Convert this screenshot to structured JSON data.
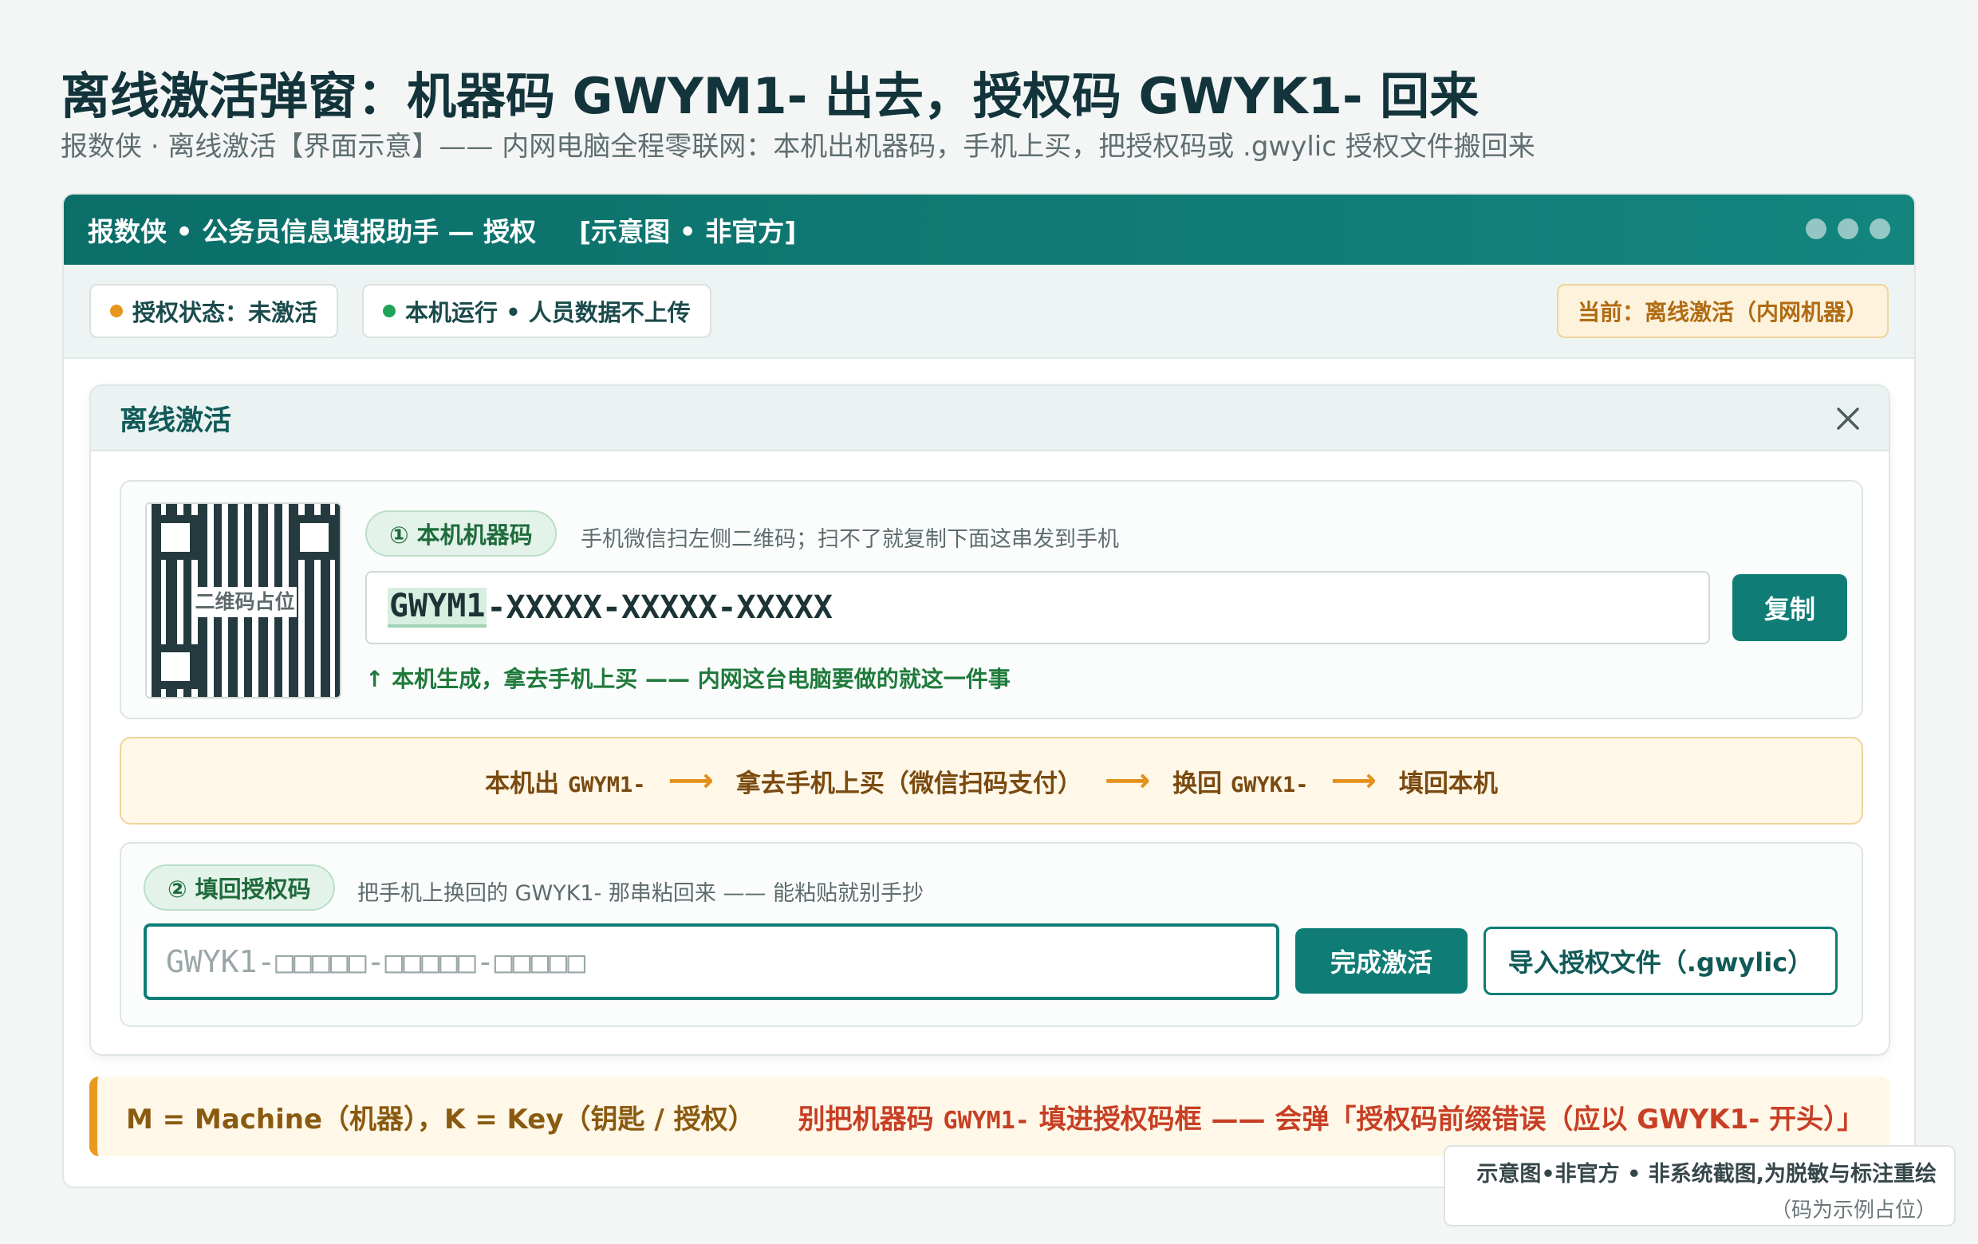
{
  "page": {
    "title": "离线激活弹窗：机器码 GWYM1- 出去，授权码 GWYK1- 回来",
    "subtitle": "报数侠 · 离线激活【界面示意】—— 内网电脑全程零联网：本机出机器码，手机上买，把授权码或 .gwylic 授权文件搬回来"
  },
  "window": {
    "title": "报数侠 • 公务员信息填报助手 — 授权",
    "tag": "[示意图 • 非官方]"
  },
  "status": {
    "license": "授权状态：未激活",
    "license_color": "#e8961e",
    "local": "本机运行 • 人员数据不上传",
    "local_color": "#22a35a",
    "current": "当前：离线激活（内网机器）"
  },
  "dialog": {
    "title": "离线激活",
    "qr_label": "二维码占位",
    "step1": {
      "badge": "① 本机机器码",
      "hint": "手机微信扫左侧二维码；扫不了就复制下面这串发到手机",
      "code_prefix": "GWYM1",
      "code_rest": "-XXXXX-XXXXX-XXXXX",
      "copy_label": "复制",
      "note": "↑ 本机生成，拿去手机上买 —— 内网这台电脑要做的就这一件事"
    },
    "flow": {
      "s1": "本机出",
      "s1_code": "GWYM1-",
      "s2": "拿去手机上买（微信扫码支付）",
      "s3": "换回",
      "s3_code": "GWYK1-",
      "s4": "填回本机"
    },
    "step2": {
      "badge": "② 填回授权码",
      "hint": "把手机上换回的 GWYK1- 那串粘回来 —— 能粘贴就别手抄",
      "placeholder": "GWYK1-□□□□□-□□□□□-□□□□□",
      "activate_label": "完成激活",
      "import_label": "导入授权文件（.gwylic）"
    }
  },
  "bottom_note": {
    "legend": "M = Machine（机器），K = Key（钥匙 / 授权）",
    "warn_a": "别把机器码",
    "warn_code": "GWYM1-",
    "warn_b": "填进授权码框 —— 会弹「授权码前缀错误（应以 GWYK1- 开头）」"
  },
  "disclaimer": {
    "line1": "示意图•非官方 • 非系统截图,为脱敏与标注重绘",
    "line2": "（码为示例占位）"
  }
}
